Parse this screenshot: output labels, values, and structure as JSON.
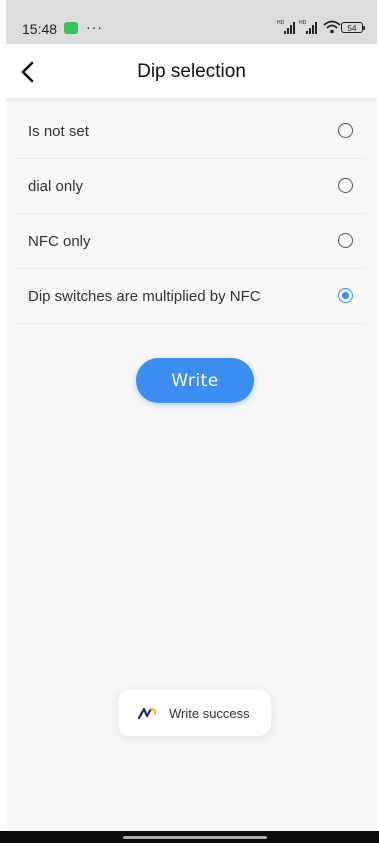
{
  "status_bar": {
    "time": "15:48",
    "dots": "···",
    "battery": "54",
    "signal_label": "HD"
  },
  "header": {
    "title": "Dip selection",
    "back_icon": "chevron-left-icon"
  },
  "options": [
    {
      "label": "Is not set",
      "selected": false
    },
    {
      "label": "dial only",
      "selected": false
    },
    {
      "label": "NFC only",
      "selected": false
    },
    {
      "label": "Dip switches are multiplied by NFC",
      "selected": true
    }
  ],
  "write_button": {
    "label": "Write"
  },
  "toast": {
    "text": "Write success",
    "icon": "app-logo-icon"
  },
  "colors": {
    "accent": "#3d8ef3",
    "background": "#f7f7f7",
    "status_bar": "#dcdcdc"
  }
}
